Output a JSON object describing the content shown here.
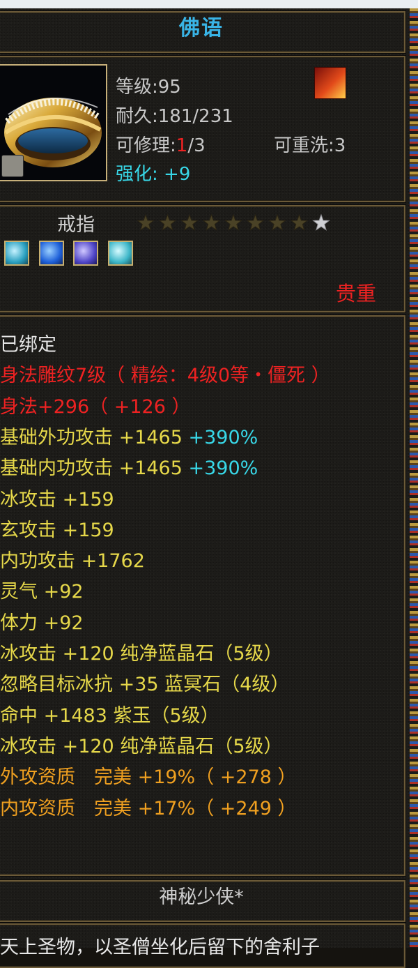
{
  "item": {
    "title": "佛语",
    "level_text": "等级:95",
    "durability_text": "耐久:181/231",
    "repair_prefix": "可修理:",
    "repair_current": "1",
    "repair_suffix": "/3",
    "rewash_text": "可重洗:3",
    "enhance_label": "强化:",
    "enhance_value": "+9",
    "type": "戒指",
    "stars": {
      "filled": 8,
      "total": 9
    },
    "quality": "贵重",
    "gems": [
      "cyan-gem-icon",
      "blue-gem-icon",
      "purple-gem-icon",
      "cyan-gem-icon"
    ]
  },
  "attributes": [
    {
      "text": "已绑定",
      "color": "#e6e6e6"
    },
    {
      "text": "身法雕纹7级（ 精绘：4级0等・僵死 ）",
      "color": "#ee2222"
    },
    {
      "text": "身法+296（ +126 ）",
      "color": "#ee2222"
    },
    {
      "text": "基础外功攻击 +1465",
      "extra": " +390%",
      "color": "#e6d84a",
      "extra_color": "#38d8e8"
    },
    {
      "text": "基础内功攻击 +1465",
      "extra": " +390%",
      "color": "#e6d84a",
      "extra_color": "#38d8e8"
    },
    {
      "text": "冰攻击 +159",
      "color": "#e6d84a"
    },
    {
      "text": "玄攻击 +159",
      "color": "#e6d84a"
    },
    {
      "text": "内功攻击 +1762",
      "color": "#e6d84a"
    },
    {
      "text": "灵气 +92",
      "color": "#e6d84a"
    },
    {
      "text": "体力 +92",
      "color": "#e6d84a"
    },
    {
      "text": "冰攻击 +120 纯净蓝晶石（5级）",
      "color": "#e6d84a"
    },
    {
      "text": "忽略目标冰抗 +35 蓝冥石（4级）",
      "color": "#e6d84a"
    },
    {
      "text": "命中 +1483 紫玉（5级）",
      "color": "#e6d84a"
    },
    {
      "text": "冰攻击 +120 纯净蓝晶石（5级）",
      "color": "#e6d84a"
    },
    {
      "text": "外攻资质　完美 +19%（ +278 ）",
      "color": "#f0a020"
    },
    {
      "text": "内攻资质　完美 +17%（ +249 ）",
      "color": "#f0a020"
    }
  ],
  "owner": "神秘少侠*",
  "description": "天上圣物，以圣僧坐化后留下的舍利子"
}
